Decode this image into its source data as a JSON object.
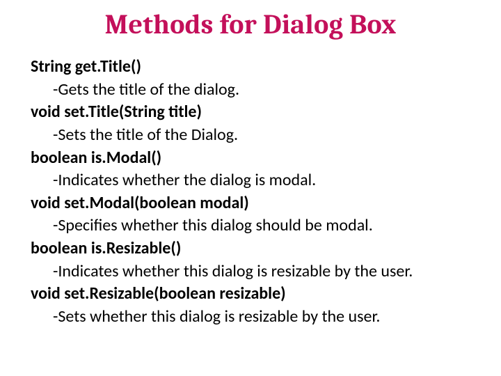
{
  "title": "Methods for Dialog Box",
  "methods": [
    {
      "signature": "String get.Title()",
      "description": "-Gets the title of the dialog."
    },
    {
      "signature": "void set.Title(String title)",
      "description": "-Sets the title of the Dialog."
    },
    {
      "signature": "boolean is.Modal()",
      "description": "-Indicates whether the dialog is modal."
    },
    {
      "signature": "void set.Modal(boolean modal)",
      "description": "-Specifies whether this dialog should be modal."
    },
    {
      "signature": "boolean is.Resizable()",
      "description": "-Indicates whether this dialog is resizable by the user."
    },
    {
      "signature": "void set.Resizable(boolean resizable)",
      "description": "-Sets whether this dialog is resizable by the user."
    }
  ]
}
